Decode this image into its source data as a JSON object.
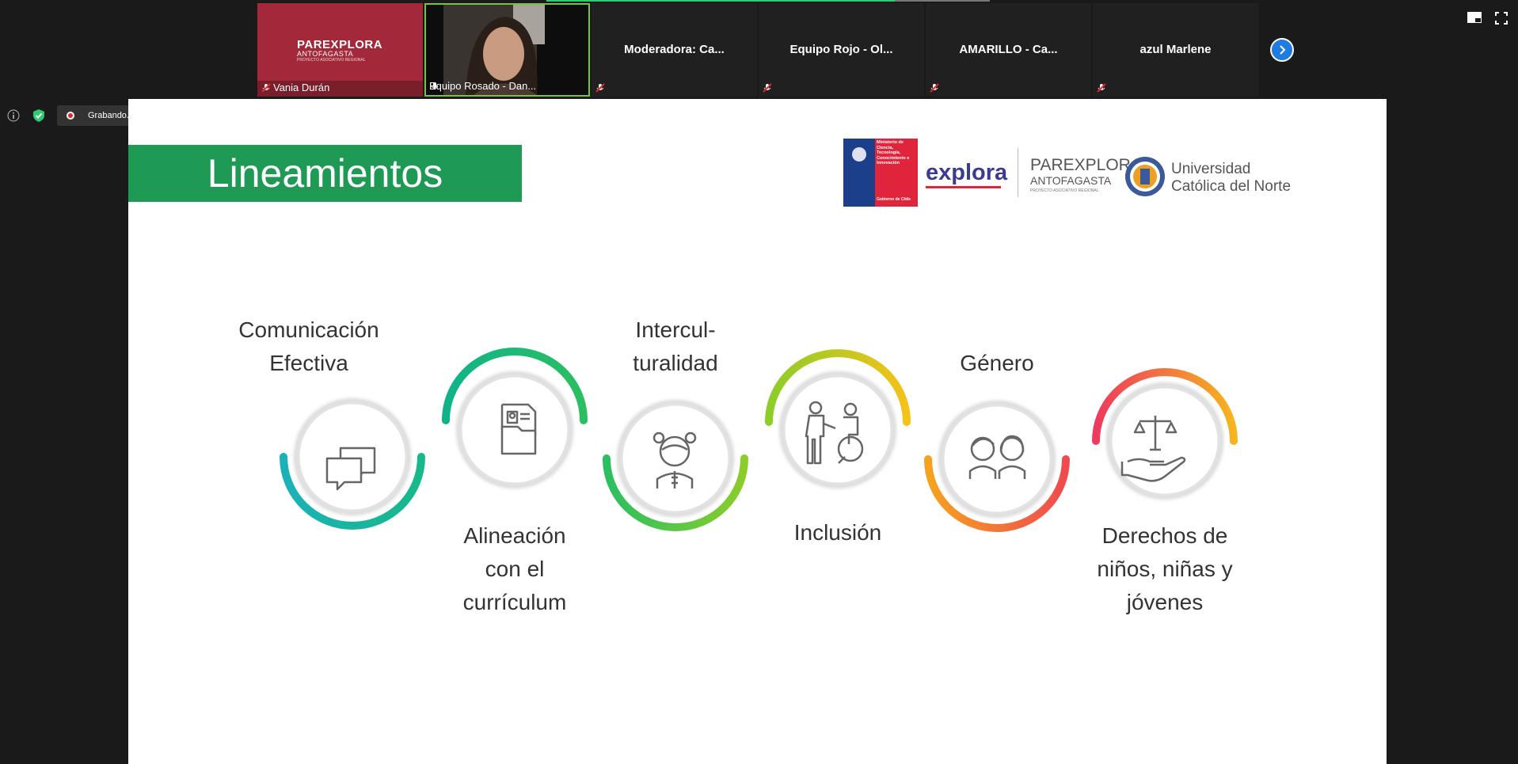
{
  "meeting": {
    "participants": [
      {
        "name": "Vania Durán",
        "type": "brand-logo",
        "brand": {
          "line1": "PAREXPLORA",
          "line2": "ANTOFAGASTA",
          "line3": "PROYECTO ASOCIATIVO REGIONAL"
        }
      },
      {
        "name": "Equipo Rosado - Dan...",
        "type": "video"
      },
      {
        "name": "Moderadora:  Ca...",
        "type": "name-only"
      },
      {
        "name": "Equipo  Rojo  - Ol...",
        "type": "name-only"
      },
      {
        "name": "AMARILLO - Ca...",
        "type": "name-only"
      },
      {
        "name": "azul Marlene",
        "type": "name-only"
      }
    ],
    "recording": {
      "status": "Grabando..."
    },
    "icons": {
      "next": "chevron-right-icon",
      "view": "speaker-view-icon",
      "fullscreen": "fullscreen-icon",
      "info": "info-icon",
      "security": "shield-check-icon"
    }
  },
  "slide": {
    "title": "Lineamientos",
    "logos": {
      "ministerio": "Ministerio de Ciencia, Tecnología, Conocimiento e Innovación",
      "gobierno": "Gobierno de Chile",
      "explora": "explora",
      "parexplora_1": "PAREXPLORA",
      "parexplora_2": "ANTOFAGASTA",
      "parexplora_3": "PROYECTO ASOCIATIVO REGIONAL",
      "universidad_1": "Universidad",
      "universidad_2": "Católica del Norte"
    },
    "items": [
      {
        "label": "Comunicación Efectiva",
        "icon": "chat-bubbles-icon"
      },
      {
        "label": "Alineación con el currículum",
        "icon": "document-folder-icon"
      },
      {
        "label": "Intercul-turalidad",
        "icon": "girl-icon"
      },
      {
        "label": "Inclusión",
        "icon": "wheelchair-assist-icon"
      },
      {
        "label": "Género",
        "icon": "boy-girl-icon"
      },
      {
        "label": "Derechos de niños, niñas y jóvenes",
        "icon": "scales-hand-icon"
      }
    ],
    "colors": {
      "title_band": "#1e9a55",
      "arc_teal": "#14b5a4",
      "arc_green": "#52c234",
      "arc_yellow": "#f0c419",
      "arc_orange": "#f58a1f",
      "arc_red": "#ef3a5d"
    }
  }
}
